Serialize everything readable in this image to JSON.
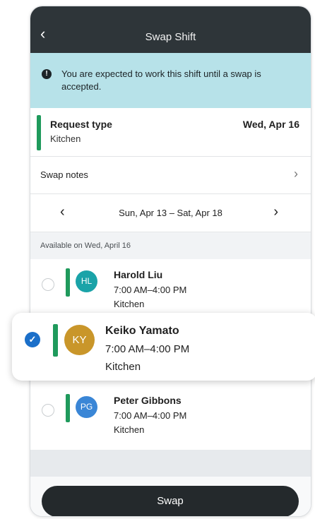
{
  "header": {
    "back_icon": "‹",
    "title": "Swap Shift"
  },
  "banner": {
    "icon": "info-icon",
    "message": "You are expected to work this shift until a swap is accepted."
  },
  "request": {
    "label": "Request type",
    "value": "Kitchen",
    "date": "Wed, Apr 16"
  },
  "notes": {
    "label": "Swap notes",
    "chevron": "›"
  },
  "range": {
    "prev": "‹",
    "text": "Sun, Apr 13 – Sat, Apr 18",
    "next": "›"
  },
  "available_header": "Available on Wed, April 16",
  "employees": [
    {
      "initials": "HL",
      "name": "Harold Liu",
      "time": "7:00 AM–4:00 PM",
      "dept": "Kitchen",
      "avatar_color": "#1aa3a8",
      "selected": false
    },
    {
      "initials": "KY",
      "name": "Keiko Yamato",
      "time": "7:00 AM–4:00 PM",
      "dept": "Kitchen",
      "avatar_color": "#c9962a",
      "selected": true
    },
    {
      "initials": "PG",
      "name": "Peter Gibbons",
      "time": "7:00 AM–4:00 PM",
      "dept": "Kitchen",
      "avatar_color": "#3a86d6",
      "selected": false
    }
  ],
  "check_mark": "✓",
  "swap_button": "Swap",
  "colors": {
    "header": "#2e3539",
    "banner": "#b7e2e9",
    "accent_green": "#1f9a5c",
    "selected_blue": "#1b6fc9",
    "button": "#24292c"
  }
}
